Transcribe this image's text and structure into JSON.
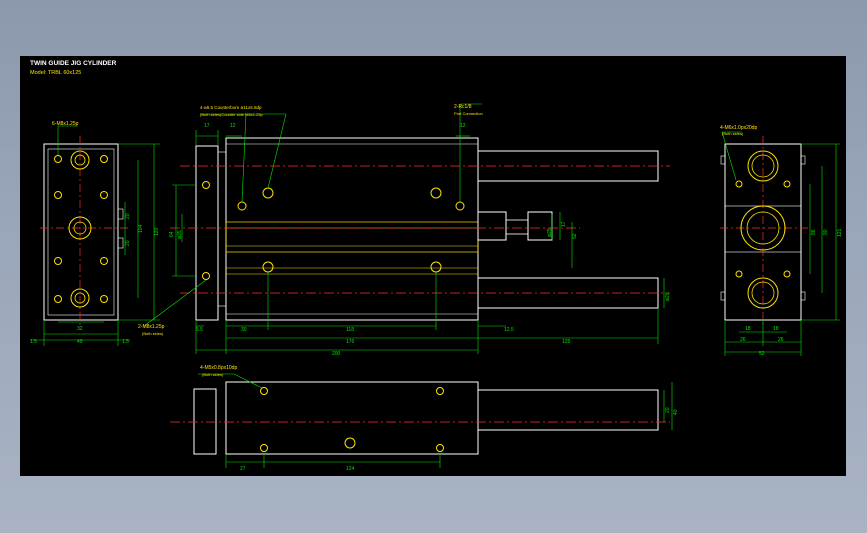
{
  "drawing": {
    "title": "TWIN GUIDE JIG CYLINDER",
    "model": "Model: TRBL 60x125"
  },
  "notes": {
    "left_top": "6-M8x1.25p",
    "top_holes_1": "4-ø6.5  Counterbore ø11x6.5dp",
    "top_holes_2": "(Both sides)Counter side M8x1.25p",
    "port_1": "2-Rc1/8",
    "port_2": "Port Connection",
    "right_top": "4-M6x1.0px20dp",
    "right_top_sub": "(Both sides)",
    "bottom_left": "2-M8x1.25p",
    "bottom_left_sub": "(Both sides)",
    "bottom_view": "4-M5x0.8px10dp",
    "bottom_view_sub": "(Both sides)"
  },
  "dims": {
    "d15_l": "1.5",
    "d49": "49",
    "d15_r": "1.5",
    "d32": "32",
    "d20a": "20",
    "d104": "104",
    "d120": "120",
    "d20b": "20",
    "d17": "17",
    "d12a": "12",
    "d12b": "12",
    "d64": "64",
    "d35": "ø35",
    "d55": "5.5",
    "d30": "30",
    "d118": "118",
    "d176": "176",
    "d200": "200",
    "d125a": "12.5",
    "d125b": "125",
    "d25": "ø25",
    "d17b": "17",
    "d52a": "52",
    "d20c": "ø20",
    "d86": "86",
    "d90": "90",
    "d121": "121",
    "d18a": "18",
    "d18b": "18",
    "d26a": "26",
    "d26b": "26",
    "d52b": "52",
    "d27": "27",
    "d124": "124",
    "d20d": "20",
    "d40": "40"
  },
  "colors": {
    "outline": "#ffffff",
    "dimension": "#00e600",
    "centerline": "#ff2a2a",
    "hole": "#ffe000",
    "note": "#ffe000"
  }
}
